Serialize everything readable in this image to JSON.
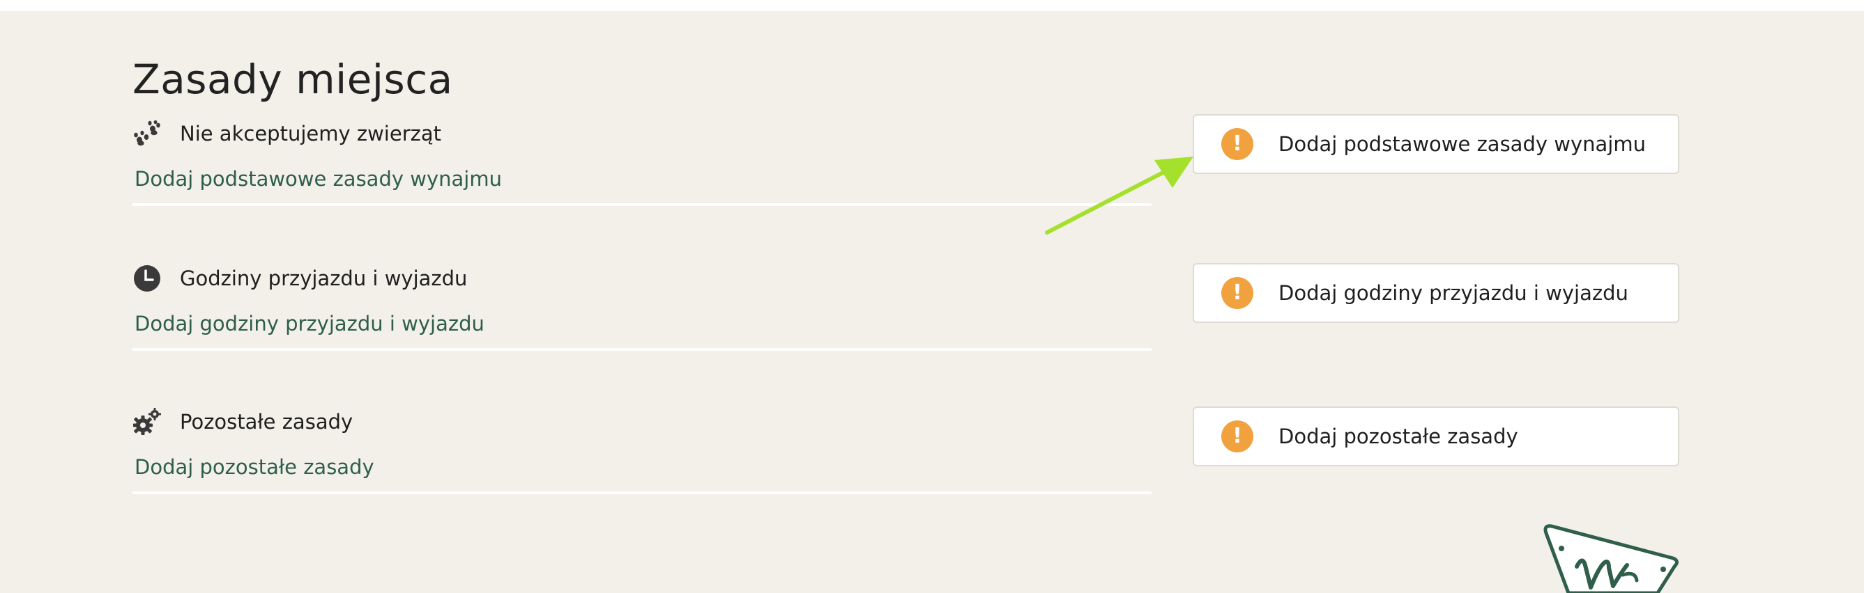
{
  "page": {
    "title": "Zasady miejsca"
  },
  "rules": [
    {
      "icon": "paw-icon",
      "title": "Nie akceptujemy zwierząt",
      "link": "Dodaj podstawowe zasady wynajmu"
    },
    {
      "icon": "clock-icon",
      "title": "Godziny przyjazdu i wyjazdu",
      "link": "Dodaj godziny przyjazdu i wyjazdu"
    },
    {
      "icon": "gears-icon",
      "title": "Pozostałe zasady",
      "link": "Dodaj pozostałe zasady"
    }
  ],
  "warnings": [
    {
      "icon": "warning-icon",
      "symbol": "!",
      "label": "Dodaj podstawowe zasady wynajmu"
    },
    {
      "icon": "warning-icon",
      "symbol": "!",
      "label": "Dodaj godziny przyjazdu i wyjazdu"
    },
    {
      "icon": "warning-icon",
      "symbol": "!",
      "label": "Dodaj pozostałe zasady"
    }
  ],
  "colors": {
    "background": "#f3f0ea",
    "link": "#2f5e4a",
    "warning": "#f2a13f",
    "annotation_arrow": "#a4e02c",
    "badge": "#2f5e4a"
  },
  "badge": {
    "icon": "brand-badge-icon"
  }
}
